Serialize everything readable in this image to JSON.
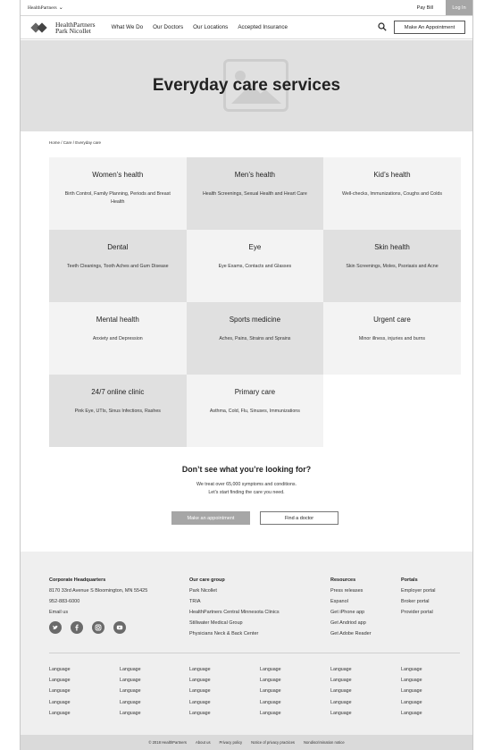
{
  "utility": {
    "brand": "HealthPartners",
    "pay_bill": "Pay Bill",
    "log_in": "Log In"
  },
  "nav": {
    "logo_line1": "HealthPartners",
    "logo_line2": "Park Nicollet",
    "links": [
      "What We Do",
      "Our Doctors",
      "Our Locations",
      "Accepted Insurance"
    ],
    "appointment": "Make An Appointment"
  },
  "hero": {
    "title": "Everyday care services"
  },
  "breadcrumb": "Home / Care / Everyday care",
  "services": [
    {
      "title": "Women’s health",
      "desc": "Birth Control, Family Planning, Periods and Breast Health"
    },
    {
      "title": "Men’s health",
      "desc": "Health Screenings, Sexual Health and Heart Care"
    },
    {
      "title": "Kid’s health",
      "desc": "Well-checks, Immunizations, Coughs and Colds"
    },
    {
      "title": "Dental",
      "desc": "Teeth Cleanings, Tooth Aches and Gum Disease"
    },
    {
      "title": "Eye",
      "desc": "Eye Exams, Contacts and Glasses"
    },
    {
      "title": "Skin health",
      "desc": "Skin Screenings, Moles, Psoriasis and Acne"
    },
    {
      "title": "Mental health",
      "desc": "Anxiety and Depression"
    },
    {
      "title": "Sports medicine",
      "desc": "Aches, Pains, Strains and Sprains"
    },
    {
      "title": "Urgent care",
      "desc": "Minor illness, injuries and burns"
    },
    {
      "title": "24/7 online clinic",
      "desc": "Pink Eye, UTIs, Sinus Infections, Rashes"
    },
    {
      "title": "Primary care",
      "desc": "Asthma, Cold, Flu, Sinuses, Immunizations"
    }
  ],
  "cta": {
    "title": "Don’t see what you’re looking for?",
    "line1": "We treat over 65,000 symptoms and conditions.",
    "line2": "Let’s start finding the care you need.",
    "make_appointment": "Make an appointment",
    "find_doctor": "Find a doctor"
  },
  "footer": {
    "hq": {
      "heading": "Corporate Headquarters",
      "address": "8170 33rd Avenue S Bloomington, MN 55425",
      "phone": "952-883-6000",
      "email": "Email us"
    },
    "care_group": {
      "heading": "Our care group",
      "items": [
        "Park Nicollet",
        "TRIA",
        "HealthPartners Central Minnesota Clinics",
        "Stillwater Medical Group",
        "Physicians Neck & Back Center"
      ]
    },
    "resources": {
      "heading": "Resources",
      "items": [
        "Press releases",
        "Espanol",
        "Get iPhone app",
        "Get Andriod app",
        "Get Adobe Reader"
      ]
    },
    "portals": {
      "heading": "Portals",
      "items": [
        "Employer portal",
        "Broker portal",
        "Provider portal"
      ]
    },
    "socials": [
      "twitter-icon",
      "facebook-icon",
      "instagram-icon",
      "youtube-icon"
    ],
    "languages": [
      [
        "Language",
        "Language",
        "Language",
        "Language",
        "Language"
      ],
      [
        "Language",
        "Language",
        "Language",
        "Language",
        "Language"
      ],
      [
        "Language",
        "Language",
        "Language",
        "Language",
        "Language"
      ],
      [
        "Language",
        "Language",
        "Language",
        "Language",
        "Language"
      ],
      [
        "Language",
        "Language",
        "Language",
        "Language",
        "Language"
      ],
      [
        "Language",
        "Language",
        "Language",
        "Language",
        "Language"
      ]
    ],
    "bottom": [
      "© 2018 HealthPartners",
      "About us",
      "Privacy policy",
      "Notice of privacy practices",
      "Nondiscrimination notice"
    ]
  }
}
